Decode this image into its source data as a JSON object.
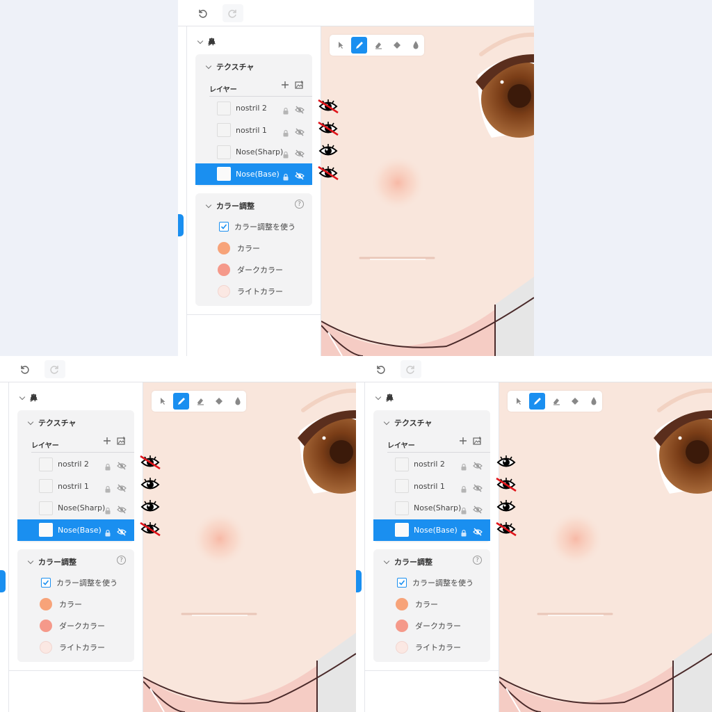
{
  "app": {
    "section_title": "鼻",
    "texture_title": "テクスチャ",
    "layers_label": "レイヤー",
    "color_title": "カラー調整",
    "use_color_adjust": "カラー調整を使う",
    "color_label": "カラー",
    "dark_color_label": "ダークカラー",
    "light_color_label": "ライトカラー",
    "help_glyph": "?"
  },
  "colors": {
    "accent": "#1a8ff0",
    "color_swatch": "#f7a379",
    "dark_swatch": "#f5998a",
    "light_swatch": "#fbe8e3",
    "skin": "#f9e6dc"
  },
  "icons": [
    "undo-icon",
    "redo-icon",
    "select-tool-icon",
    "pen-tool-icon",
    "eraser-tool-icon",
    "fill-tool-icon",
    "dropper-tool-icon",
    "add-layer-icon",
    "add-image-icon",
    "lock-icon",
    "eye-off-icon",
    "eye-icon"
  ],
  "panels": [
    {
      "layers": [
        {
          "name": "nostril 2",
          "selected": false,
          "hidden": true
        },
        {
          "name": "nostril 1",
          "selected": false,
          "hidden": true
        },
        {
          "name": "Nose(Sharp)",
          "selected": false,
          "hidden": false
        },
        {
          "name": "Nose(Base)",
          "selected": true,
          "hidden": true
        }
      ]
    },
    {
      "layers": [
        {
          "name": "nostril 2",
          "selected": false,
          "hidden": true
        },
        {
          "name": "nostril 1",
          "selected": false,
          "hidden": false
        },
        {
          "name": "Nose(Sharp)",
          "selected": false,
          "hidden": false
        },
        {
          "name": "Nose(Base)",
          "selected": true,
          "hidden": true
        }
      ]
    },
    {
      "layers": [
        {
          "name": "nostril 2",
          "selected": false,
          "hidden": false
        },
        {
          "name": "nostril 1",
          "selected": false,
          "hidden": true
        },
        {
          "name": "Nose(Sharp)",
          "selected": false,
          "hidden": false
        },
        {
          "name": "Nose(Base)",
          "selected": true,
          "hidden": true
        }
      ]
    }
  ]
}
